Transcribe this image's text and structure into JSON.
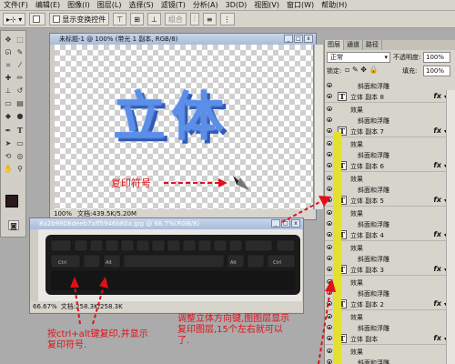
{
  "menu": [
    "文件(F)",
    "编辑(E)",
    "图像(I)",
    "图层(L)",
    "选择(S)",
    "滤镜(T)",
    "分析(A)",
    "3D(D)",
    "视图(V)",
    "窗口(W)",
    "帮助(H)"
  ],
  "options": {
    "show_transform": "显示变换控件",
    "combine": "组合"
  },
  "doc1": {
    "title": "未标题-1 @ 100% (带光 1 副本, RGB/8)",
    "canvas_text": "立体",
    "label": "复印符号",
    "zoom": "100%",
    "doc_info": "文档:439.5K/5.20M"
  },
  "doc2": {
    "title": "8a2b9808deeb7aff5946b80a.jpg @ 66.7%(RGB/8)",
    "zoom": "66.67%",
    "doc_info": "文档:258.3K/258.3K",
    "keys": [
      "Ctrl",
      "Alt",
      "Alt",
      "Ctrl"
    ]
  },
  "layers_panel": {
    "tabs": [
      "图层",
      "通道",
      "路径"
    ],
    "blend_mode": "正常",
    "opacity_label": "不透明度:",
    "opacity": "100%",
    "lock_label": "锁定:",
    "fill_label": "填充:",
    "fill": "100%",
    "rows": [
      {
        "type": "sub",
        "text": "斜面和浮雕"
      },
      {
        "type": "layer",
        "name": "立体 副本 8"
      },
      {
        "type": "sub",
        "text": "效果"
      },
      {
        "type": "sub",
        "text": "斜面和浮雕"
      },
      {
        "type": "layer",
        "name": "立体 副本 7"
      },
      {
        "type": "sub",
        "text": "效果"
      },
      {
        "type": "sub",
        "text": "斜面和浮雕"
      },
      {
        "type": "layer",
        "name": "立体 副本 6"
      },
      {
        "type": "sub",
        "text": "效果"
      },
      {
        "type": "sub",
        "text": "斜面和浮雕"
      },
      {
        "type": "layer",
        "name": "立体 副本 5"
      },
      {
        "type": "sub",
        "text": "效果"
      },
      {
        "type": "sub",
        "text": "斜面和浮雕"
      },
      {
        "type": "layer",
        "name": "立体 副本 4"
      },
      {
        "type": "sub",
        "text": "效果"
      },
      {
        "type": "sub",
        "text": "斜面和浮雕"
      },
      {
        "type": "layer",
        "name": "立体 副本 3"
      },
      {
        "type": "sub",
        "text": "效果"
      },
      {
        "type": "sub",
        "text": "斜面和浮雕"
      },
      {
        "type": "layer",
        "name": "立体 副本 2"
      },
      {
        "type": "sub",
        "text": "效果"
      },
      {
        "type": "sub",
        "text": "斜面和浮雕"
      },
      {
        "type": "layer",
        "name": "立体 副本"
      },
      {
        "type": "sub",
        "text": "效果"
      },
      {
        "type": "sub",
        "text": "斜面和浮雕"
      }
    ]
  },
  "annotations": {
    "left": "按ctrl+alt键复印,并显示复印符号.",
    "right": "调整立体方向键,图图层显示复印图层,15个左右就可以了."
  },
  "colors": {
    "annotation": "#e0101a",
    "text3d": "#4a7fe0",
    "highlight": "#e4e030"
  }
}
